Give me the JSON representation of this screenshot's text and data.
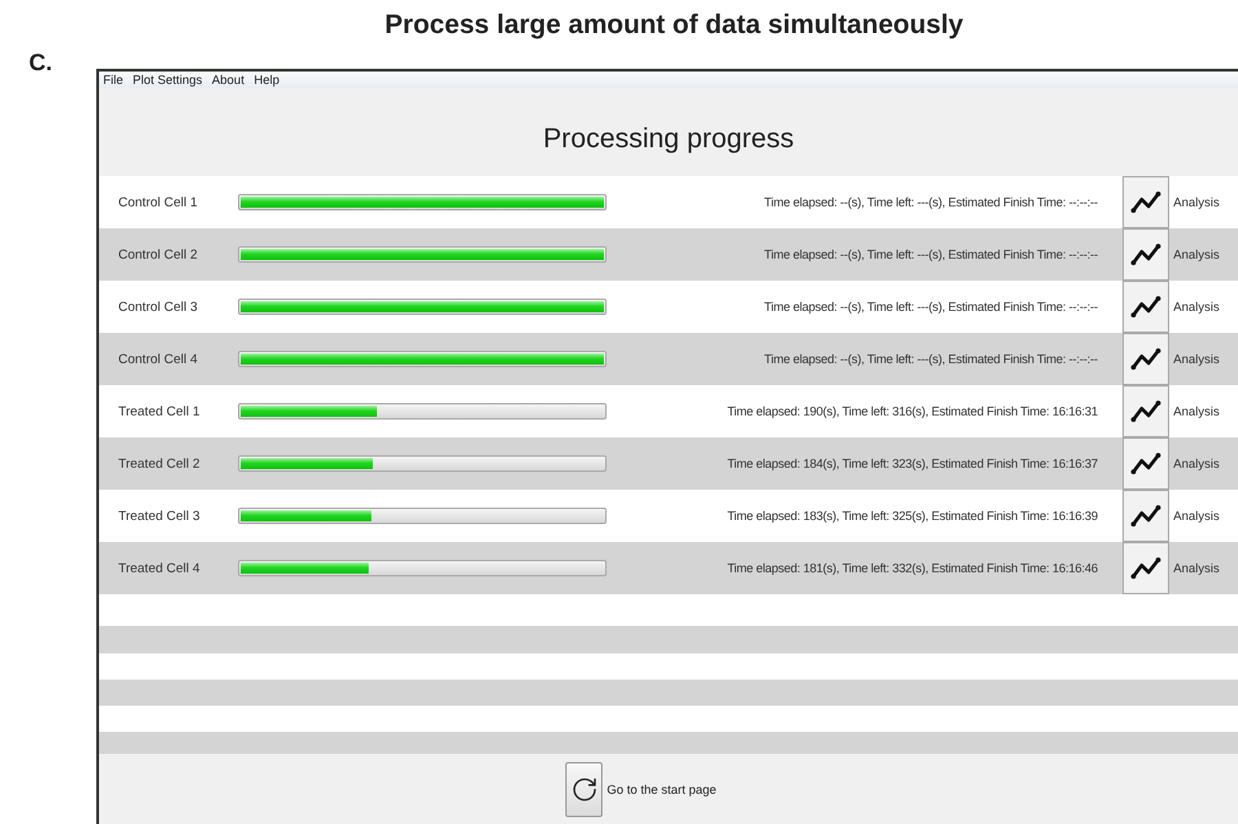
{
  "figure": {
    "heading": "Process large amount of data simultaneously",
    "panel_label": "C."
  },
  "menu": [
    "File",
    "Plot Settings",
    "About",
    "Help"
  ],
  "title": "Processing progress",
  "rows": [
    {
      "name": "Control Cell 1",
      "level": 1,
      "status": "Time elapsed: --(s), Time left: ---(s), Estimated Finish Time: --:--:--",
      "action": "Analysis"
    },
    {
      "name": "Control Cell 2",
      "level": 1,
      "status": "Time elapsed: --(s), Time left: ---(s), Estimated Finish Time: --:--:--",
      "action": "Analysis"
    },
    {
      "name": "Control Cell 3",
      "level": 1,
      "status": "Time elapsed: --(s), Time left: ---(s), Estimated Finish Time: --:--:--",
      "action": "Analysis"
    },
    {
      "name": "Control Cell 4",
      "level": 1,
      "status": "Time elapsed: --(s), Time left: ---(s), Estimated Finish Time: --:--:--",
      "action": "Analysis"
    },
    {
      "name": "Treated Cell 1",
      "level": 0.375,
      "status": "Time elapsed: 190(s), Time left: 316(s), Estimated Finish Time: 16:16:31",
      "action": "Analysis"
    },
    {
      "name": "Treated Cell 2",
      "level": 0.363,
      "status": "Time elapsed: 184(s), Time left: 323(s), Estimated Finish Time: 16:16:37",
      "action": "Analysis"
    },
    {
      "name": "Treated Cell 3",
      "level": 0.36,
      "status": "Time elapsed: 183(s), Time left: 325(s), Estimated Finish Time: 16:16:39",
      "action": "Analysis"
    },
    {
      "name": "Treated Cell 4",
      "level": 0.353,
      "status": "Time elapsed: 181(s), Time left: 332(s), Estimated Finish Time: 16:16:46",
      "action": "Analysis"
    }
  ],
  "footer": {
    "button": "Go to the start page"
  }
}
